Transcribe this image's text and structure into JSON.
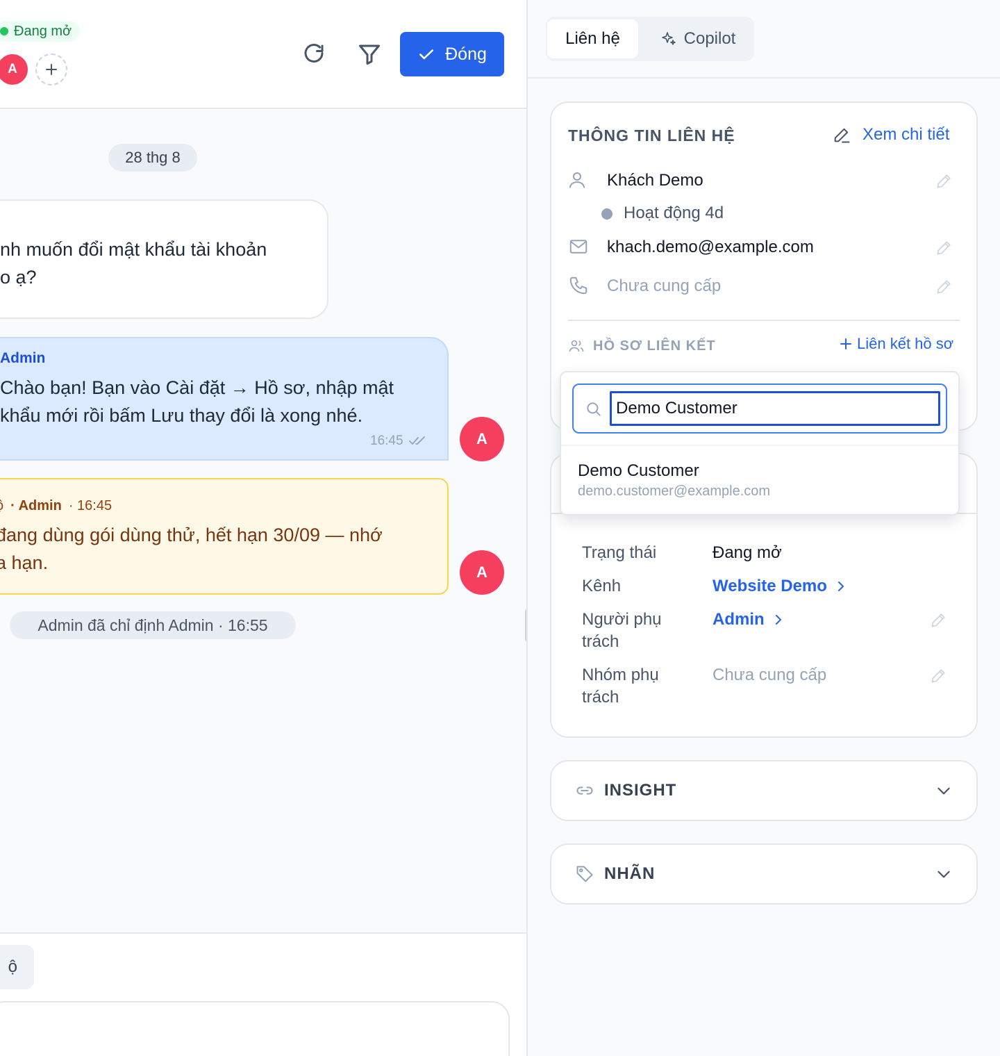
{
  "conversation": {
    "status": "Đang mở",
    "assignee_initial": "A",
    "close_label": "Đóng",
    "date_divider": "28 thg 8",
    "incoming_message": "nh muốn đổi mật khẩu tài khoản\no ạ?",
    "outgoing": {
      "sender": "Admin",
      "text": "Chào bạn! Bạn vào Cài đặt → Hồ sơ, nhập mật\nkhẩu mới rồi bấm Lưu thay đổi là xong nhé.",
      "time": "16:45",
      "avatar_initial": "A"
    },
    "private_note": {
      "prefix": "ộ",
      "sender": "· Admin",
      "time": "· 16:45",
      "text": "đang dùng gói dùng thử, hết hạn 30/09 — nhớ\na hạn.",
      "avatar_initial": "A"
    },
    "activity": "Admin đã chỉ định Admin · 16:55",
    "reply_tab_label": "ộ"
  },
  "sidebar": {
    "tabs": [
      {
        "label": "Liên hệ",
        "active": true
      },
      {
        "label": "Copilot",
        "active": false
      }
    ],
    "contact": {
      "heading": "THÔNG TIN LIÊN HỆ",
      "view_details": "Xem chi tiết",
      "name": "Khách Demo",
      "presence": "Hoạt động 4d",
      "email": "khach.demo@example.com",
      "phone": "Chưa cung cấp"
    },
    "linked_profiles": {
      "heading": "HỒ SƠ LIÊN KẾT",
      "link_label": "Liên kết hồ sơ"
    },
    "search": {
      "value": "Demo Customer",
      "placeholder": "",
      "result_name": "Demo Customer",
      "result_email": "demo.customer@example.com"
    },
    "attributes": {
      "status_label": "Trạng thái",
      "status_value": "Đang mở",
      "channel_label": "Kênh",
      "channel_value": "Website Demo",
      "assignee_label": "Người phụ\ntrách",
      "assignee_value": "Admin",
      "team_label": "Nhóm phụ\ntrách",
      "team_value": "Chưa cung cấp"
    },
    "sections": {
      "insight": "INSIGHT",
      "tags": "NHÃN"
    }
  },
  "colors": {
    "primary": "#2563eb",
    "status_green": "#22c55e",
    "avatar": "#f43f5e",
    "note_bg": "#fef9e7",
    "note_border": "#fcd34d",
    "outgoing_bg": "#dbeafe"
  },
  "icons": [
    "refresh-icon",
    "filter-icon",
    "check-icon",
    "plus-icon",
    "sparkle-icon",
    "edit-icon",
    "user-icon",
    "mail-icon",
    "phone-icon",
    "users-icon",
    "search-icon",
    "chevron-right-icon",
    "chevron-down-icon",
    "link-icon",
    "tag-icon",
    "double-check-icon"
  ]
}
